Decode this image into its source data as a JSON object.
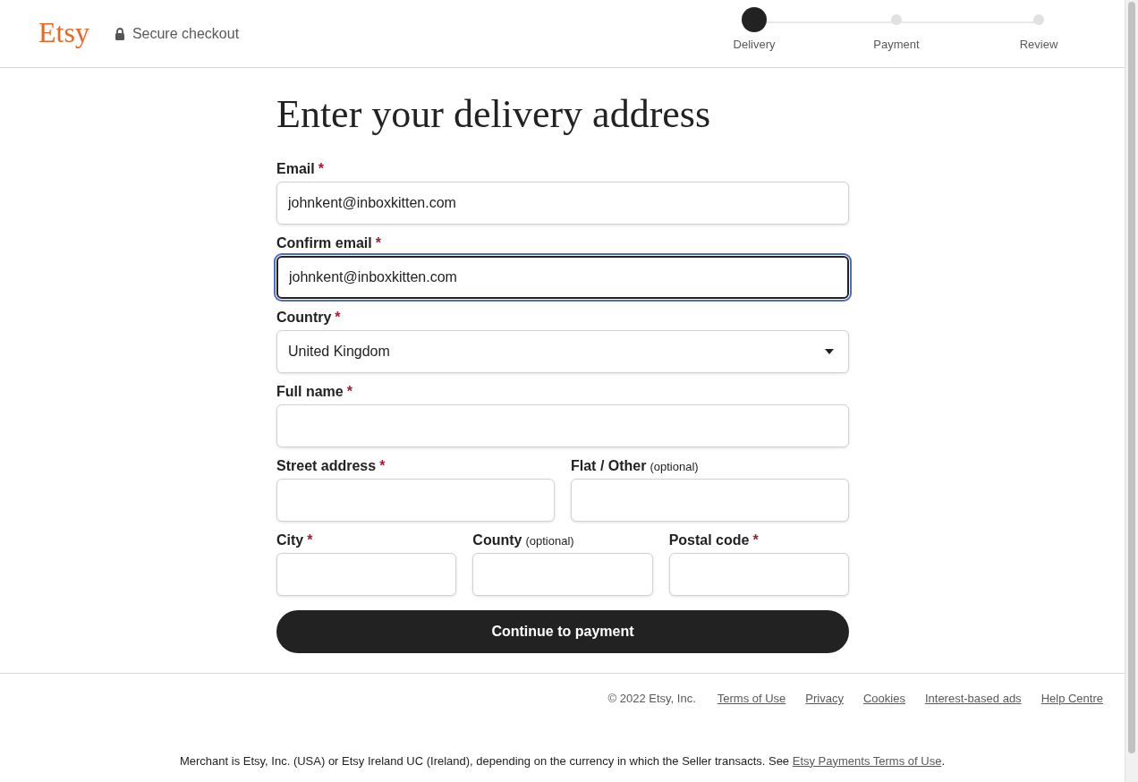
{
  "header": {
    "logo": "Etsy",
    "secure_label": "Secure checkout"
  },
  "steps": [
    {
      "label": "Delivery",
      "selected": true
    },
    {
      "label": "Payment",
      "selected": false
    },
    {
      "label": "Review",
      "selected": false
    }
  ],
  "title": "Enter your delivery address",
  "form_rows": [
    [
      {
        "kind": "text",
        "label": "Email",
        "required_mark": "*",
        "value": "johnkent@inboxkitten.com",
        "focused": false
      }
    ],
    [
      {
        "kind": "text",
        "label": "Confirm email",
        "required_mark": "*",
        "value": "johnkent@inboxkitten.com",
        "focused": true
      }
    ],
    [
      {
        "kind": "select",
        "label": "Country",
        "required_mark": "*",
        "value": "United Kingdom",
        "focused": false
      }
    ],
    [
      {
        "kind": "text",
        "label": "Full name",
        "required_mark": "*",
        "focused": false
      }
    ],
    [
      {
        "kind": "text",
        "label": "Street address",
        "required_mark": "*",
        "focused": false
      },
      {
        "kind": "text",
        "label": "Flat / Other",
        "optional_note": "(optional)",
        "focused": false
      }
    ],
    [
      {
        "kind": "text",
        "label": "City",
        "required_mark": "*",
        "focused": false
      },
      {
        "kind": "text",
        "label": "County",
        "optional_note": "(optional)",
        "focused": false
      },
      {
        "kind": "text",
        "label": "Postal code",
        "required_mark": "*",
        "focused": false
      }
    ]
  ],
  "submit_button": "Continue to payment",
  "footer": {
    "copyright": "© 2022 Etsy, Inc.",
    "links": [
      "Terms of Use",
      "Privacy",
      "Cookies",
      "Interest-based ads",
      "Help Centre"
    ],
    "merchant_text": "Merchant is Etsy, Inc. (USA) or Etsy Ireland UC (Ireland), depending on the currency in which the Seller transacts. See ",
    "merchant_link": "Etsy Payments Terms of Use",
    "merchant_end": "."
  }
}
